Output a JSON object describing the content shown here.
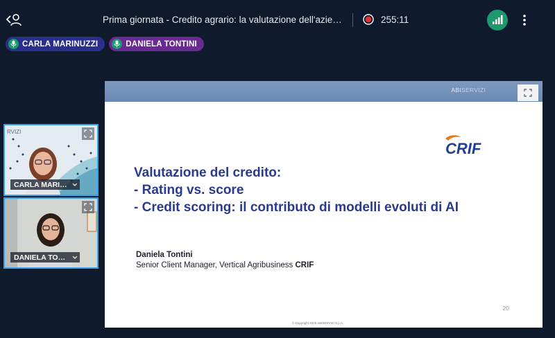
{
  "header": {
    "meeting_title": "Prima giornata - Credito agrario: la valutazione dell'azienda ag...",
    "timer": "255:11",
    "back_icon": "back-user-icon",
    "record_icon": "record-icon",
    "signal_icon": "signal-icon",
    "more_icon": "more-vertical-icon"
  },
  "speakers": [
    {
      "name": "CARLA MARINUZZI",
      "color": "#2a2f8c"
    },
    {
      "name": "DANIELA TONTINI",
      "color": "#6a2a93"
    }
  ],
  "videos": [
    {
      "name": "CARLA MARIN...",
      "brand": "RVIZI"
    },
    {
      "name": "DANIELA TON..."
    }
  ],
  "slide": {
    "header_logo_main": "ABI",
    "header_logo_sub": "SERVIZI",
    "crif_logo": "CRIF",
    "title_lines": [
      "Valutazione del credito:",
      "- Rating vs. score",
      "- Credit scoring: il contributo di modelli evoluti di AI"
    ],
    "presenter_name": "Daniela Tontini",
    "presenter_role": "Senior Client Manager, Vertical Agribusiness",
    "presenter_company": "CRIF",
    "page_number": "20",
    "copyright": "© Copyright 2025 ABISERVIZI S.p.A."
  },
  "colors": {
    "background": "#0f1b2c",
    "accent_green": "#1c9a6e",
    "record_red": "#e0313b",
    "title_blue": "#2a3a8c",
    "tile_border": "#3aa0e8"
  }
}
